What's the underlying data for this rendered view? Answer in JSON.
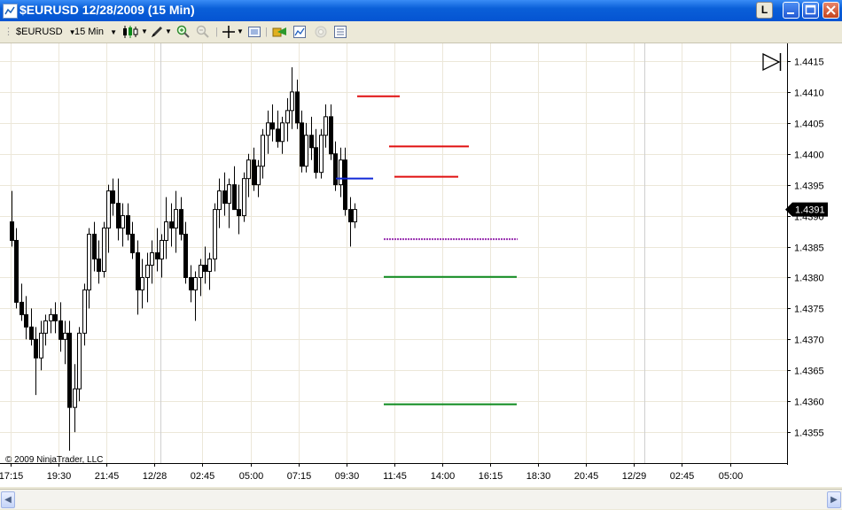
{
  "window": {
    "title": "$EURUSD  12/28/2009 (15 Min)",
    "btn_l": "L"
  },
  "toolbar": {
    "instrument": "$EURUSD",
    "interval": "15 Min"
  },
  "chart": {
    "copyright": "© 2009 NinjaTrader, LLC",
    "current_price_label": "1.4391",
    "colors": {
      "up": "#ffffff",
      "down": "#000000",
      "resistance": "#e01010",
      "support": "#0d8a1f",
      "pivot": "#1028d8",
      "dotted": "#9a30b0",
      "grid": "#ece7d9",
      "price_tag": "#000000"
    },
    "y_ticks": [
      "1.4415",
      "1.4410",
      "1.4405",
      "1.4400",
      "1.4395",
      "1.4390",
      "1.4385",
      "1.4380",
      "1.4375",
      "1.4370",
      "1.4365",
      "1.4360",
      "1.4355"
    ],
    "x_ticks": [
      "17:15",
      "19:30",
      "21:45",
      "12/28",
      "02:45",
      "05:00",
      "07:15",
      "09:30",
      "11:45",
      "14:00",
      "16:15",
      "18:30",
      "20:45",
      "12/29",
      "02:45",
      "05:00"
    ]
  },
  "chart_data": {
    "type": "candlestick",
    "ylim": [
      1.435,
      1.4417
    ],
    "current_price": 1.4391,
    "levels": [
      {
        "kind": "resistance",
        "price": 1.44093
      },
      {
        "kind": "resistance",
        "price": 1.44012
      },
      {
        "kind": "resistance",
        "price": 1.43963
      },
      {
        "kind": "pivot",
        "price": 1.4396
      },
      {
        "kind": "dotted",
        "price": 1.43862
      },
      {
        "kind": "support",
        "price": 1.43801
      },
      {
        "kind": "support",
        "price": 1.43595
      }
    ],
    "candles": [
      [
        1.4389,
        1.4394,
        1.4385,
        1.4386
      ],
      [
        1.4386,
        1.4388,
        1.4375,
        1.4376
      ],
      [
        1.4376,
        1.4379,
        1.4373,
        1.4374
      ],
      [
        1.4374,
        1.4377,
        1.437,
        1.4372
      ],
      [
        1.4372,
        1.4375,
        1.4369,
        1.437
      ],
      [
        1.437,
        1.4372,
        1.4361,
        1.4367
      ],
      [
        1.4367,
        1.4373,
        1.4365,
        1.4371
      ],
      [
        1.4371,
        1.4374,
        1.4369,
        1.4373
      ],
      [
        1.4373,
        1.4375,
        1.4371,
        1.4374
      ],
      [
        1.4374,
        1.4376,
        1.4371,
        1.4373
      ],
      [
        1.4373,
        1.4376,
        1.4368,
        1.437
      ],
      [
        1.437,
        1.4373,
        1.4366,
        1.4371
      ],
      [
        1.4371,
        1.4373,
        1.4352,
        1.4359
      ],
      [
        1.4359,
        1.4366,
        1.4355,
        1.4362
      ],
      [
        1.4362,
        1.4372,
        1.436,
        1.4371
      ],
      [
        1.4371,
        1.4379,
        1.4369,
        1.4378
      ],
      [
        1.4378,
        1.4388,
        1.4375,
        1.4387
      ],
      [
        1.4387,
        1.4389,
        1.4381,
        1.4383
      ],
      [
        1.4383,
        1.4386,
        1.4379,
        1.4381
      ],
      [
        1.4381,
        1.4389,
        1.438,
        1.4388
      ],
      [
        1.4388,
        1.4395,
        1.4384,
        1.4394
      ],
      [
        1.4394,
        1.4396,
        1.439,
        1.4392
      ],
      [
        1.4392,
        1.4396,
        1.4386,
        1.4388
      ],
      [
        1.4388,
        1.4392,
        1.4385,
        1.439
      ],
      [
        1.439,
        1.4392,
        1.4386,
        1.4387
      ],
      [
        1.4387,
        1.4389,
        1.4383,
        1.4384
      ],
      [
        1.4384,
        1.4386,
        1.4374,
        1.4378
      ],
      [
        1.4378,
        1.4383,
        1.4375,
        1.438
      ],
      [
        1.438,
        1.4384,
        1.4376,
        1.4382
      ],
      [
        1.4382,
        1.4386,
        1.4379,
        1.4384
      ],
      [
        1.4384,
        1.4388,
        1.4381,
        1.4383
      ],
      [
        1.4383,
        1.4387,
        1.438,
        1.4386
      ],
      [
        1.4386,
        1.4393,
        1.4383,
        1.4389
      ],
      [
        1.4389,
        1.4392,
        1.4385,
        1.4388
      ],
      [
        1.4388,
        1.4394,
        1.4384,
        1.4391
      ],
      [
        1.4391,
        1.4393,
        1.4386,
        1.4387
      ],
      [
        1.4387,
        1.4389,
        1.4379,
        1.438
      ],
      [
        1.438,
        1.4382,
        1.4376,
        1.4378
      ],
      [
        1.4378,
        1.4381,
        1.4373,
        1.438
      ],
      [
        1.438,
        1.4383,
        1.4377,
        1.4382
      ],
      [
        1.4382,
        1.4385,
        1.4379,
        1.4381
      ],
      [
        1.4381,
        1.4384,
        1.4378,
        1.4383
      ],
      [
        1.4383,
        1.4392,
        1.4381,
        1.4391
      ],
      [
        1.4391,
        1.4396,
        1.4388,
        1.4394
      ],
      [
        1.4394,
        1.4397,
        1.439,
        1.4392
      ],
      [
        1.4392,
        1.4396,
        1.4388,
        1.4395
      ],
      [
        1.4395,
        1.4398,
        1.4391,
        1.4391
      ],
      [
        1.4391,
        1.4395,
        1.4387,
        1.439
      ],
      [
        1.439,
        1.4397,
        1.4389,
        1.4396
      ],
      [
        1.4396,
        1.44,
        1.4393,
        1.4399
      ],
      [
        1.4399,
        1.4401,
        1.4394,
        1.4395
      ],
      [
        1.4395,
        1.4399,
        1.4393,
        1.4398
      ],
      [
        1.4398,
        1.4404,
        1.4396,
        1.4403
      ],
      [
        1.4403,
        1.4407,
        1.44,
        1.4405
      ],
      [
        1.4405,
        1.4408,
        1.4402,
        1.4404
      ],
      [
        1.4404,
        1.4407,
        1.4401,
        1.4402
      ],
      [
        1.4402,
        1.4406,
        1.44,
        1.4405
      ],
      [
        1.4405,
        1.4409,
        1.4402,
        1.4407
      ],
      [
        1.4407,
        1.4414,
        1.4404,
        1.441
      ],
      [
        1.441,
        1.4412,
        1.4404,
        1.4405
      ],
      [
        1.4405,
        1.4407,
        1.4397,
        1.4398
      ],
      [
        1.4398,
        1.4405,
        1.4397,
        1.4403
      ],
      [
        1.4403,
        1.4406,
        1.4399,
        1.4401
      ],
      [
        1.4401,
        1.4404,
        1.4396,
        1.4397
      ],
      [
        1.4397,
        1.4404,
        1.4396,
        1.4403
      ],
      [
        1.4403,
        1.4408,
        1.4401,
        1.4406
      ],
      [
        1.4406,
        1.4408,
        1.4399,
        1.44
      ],
      [
        1.44,
        1.4402,
        1.4394,
        1.4395
      ],
      [
        1.4395,
        1.4401,
        1.4393,
        1.4399
      ],
      [
        1.4399,
        1.4401,
        1.439,
        1.4391
      ],
      [
        1.4391,
        1.4393,
        1.4385,
        1.4389
      ],
      [
        1.4389,
        1.4392,
        1.4388,
        1.4391
      ]
    ]
  }
}
